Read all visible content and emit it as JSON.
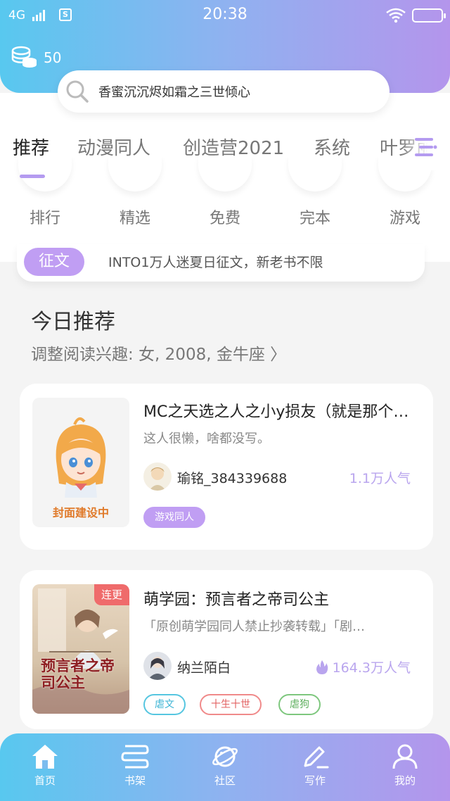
{
  "status_bar": {
    "network": "4G",
    "time": "20:38"
  },
  "coins": {
    "count": "50"
  },
  "search": {
    "placeholder": "香蜜沉沉烬如霜之三世倾心"
  },
  "tabs": [
    {
      "label": "推荐",
      "active": true
    },
    {
      "label": "动漫同人"
    },
    {
      "label": "创造营2021"
    },
    {
      "label": "系统"
    },
    {
      "label": "叶罗丽..."
    }
  ],
  "categories": [
    {
      "label": "排行"
    },
    {
      "label": "精选"
    },
    {
      "label": "免费"
    },
    {
      "label": "完本"
    },
    {
      "label": "游戏"
    }
  ],
  "notice": {
    "badge": "征文",
    "text": "INTO1万人迷夏日征文，新老书不限"
  },
  "recommend": {
    "title": "今日推荐",
    "preference": "调整阅读兴趣: 女, 2008, 金牛座 〉"
  },
  "books": [
    {
      "title": "MC之天选之人之小y损友（就是那个…",
      "desc": "这人很懒，啥都没写。",
      "author": "瑜铭_384339688",
      "popularity": "1.1万人气",
      "cover_text": "封面建设中",
      "tags": [
        "游戏同人"
      ]
    },
    {
      "title": "萌学园：预言者之帝司公主",
      "desc": "「原创萌学园同人禁止抄袭转载」「剧…",
      "author": "纳兰陌白",
      "popularity": "164.3万人气",
      "ribbon": "连更",
      "cover_title": "预言者之帝司公主",
      "tags": [
        "虐文",
        "十生十世",
        "虐狗"
      ]
    }
  ],
  "bottom_nav": [
    {
      "label": "首页",
      "active": true
    },
    {
      "label": "书架"
    },
    {
      "label": "社区"
    },
    {
      "label": "写作"
    },
    {
      "label": "我的"
    }
  ],
  "colors": {
    "gradient_start": "#58c8ef",
    "gradient_end": "#b495ec",
    "accent_purple": "#c09ef3",
    "popularity": "#b9a5ee",
    "ribbon_red": "#ef6b6b"
  }
}
